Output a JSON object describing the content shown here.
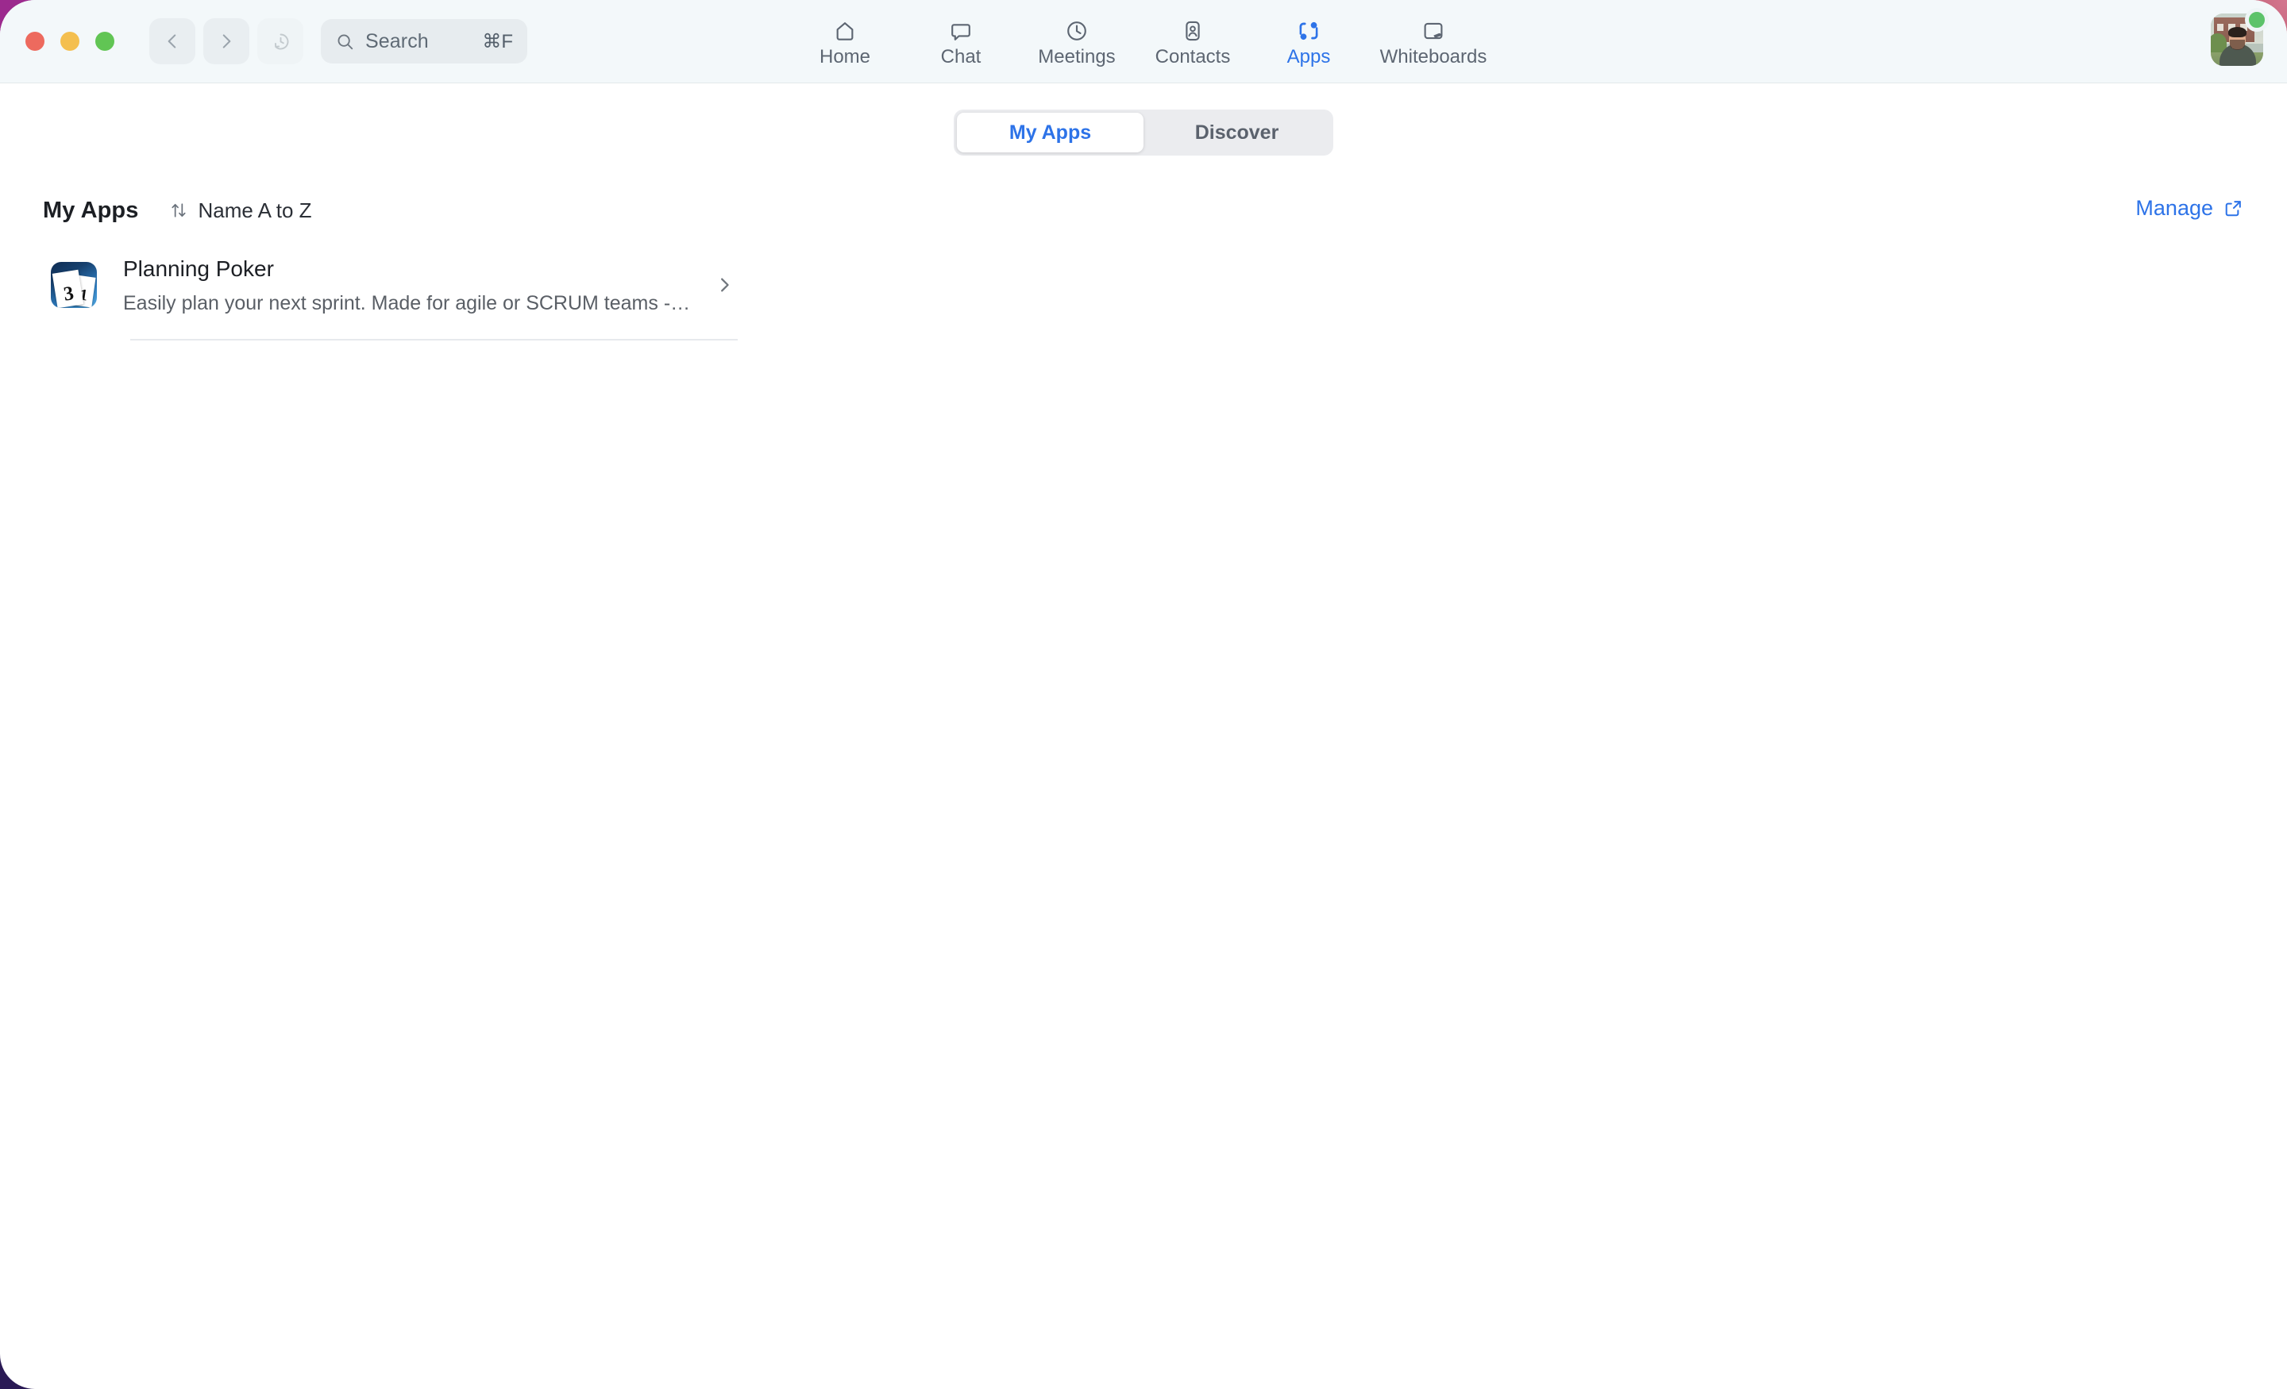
{
  "window": {
    "traffic_lights": [
      {
        "name": "close",
        "color": "#ed6a5e"
      },
      {
        "name": "minimize",
        "color": "#f4bf4f"
      },
      {
        "name": "zoom",
        "color": "#61c554"
      }
    ]
  },
  "titlebar": {
    "back_icon": "chevron-left-icon",
    "forward_icon": "chevron-right-icon",
    "history_icon": "clock-rewind-icon",
    "search": {
      "icon": "search-icon",
      "placeholder": "Search",
      "shortcut": "⌘F"
    },
    "tabs": [
      {
        "label": "Home",
        "icon": "home-icon",
        "active": false
      },
      {
        "label": "Chat",
        "icon": "chat-bubble-icon",
        "active": false
      },
      {
        "label": "Meetings",
        "icon": "clock-icon",
        "active": false
      },
      {
        "label": "Contacts",
        "icon": "contact-card-icon",
        "active": false
      },
      {
        "label": "Apps",
        "icon": "apps-icon",
        "active": true
      },
      {
        "label": "Whiteboards",
        "icon": "whiteboard-icon",
        "active": false
      }
    ],
    "avatar": {
      "name": "user-avatar",
      "presence": "available",
      "presence_color": "#5cc36a"
    }
  },
  "segmented_tabs": {
    "items": [
      {
        "label": "My Apps",
        "active": true
      },
      {
        "label": "Discover",
        "active": false
      }
    ]
  },
  "content": {
    "section_title": "My Apps",
    "sort": {
      "icon": "sort-arrows-icon",
      "label": "Name A to Z"
    },
    "manage": {
      "label": "Manage",
      "icon": "external-link-icon"
    },
    "apps": [
      {
        "name": "Planning Poker",
        "description": "Easily plan your next sprint. Made for agile or SCRUM teams - vote coll…",
        "icon": {
          "name": "planning-poker-icon",
          "card_front_value": "3",
          "card_back_value": "1"
        },
        "chevron": "chevron-right-icon"
      }
    ]
  },
  "colors": {
    "accent": "#2d73e8",
    "titlebar_bg": "#f3f8fa",
    "content_bg": "#ffffff",
    "segment_bg": "#ebecef",
    "muted_text": "#5a5f66"
  }
}
